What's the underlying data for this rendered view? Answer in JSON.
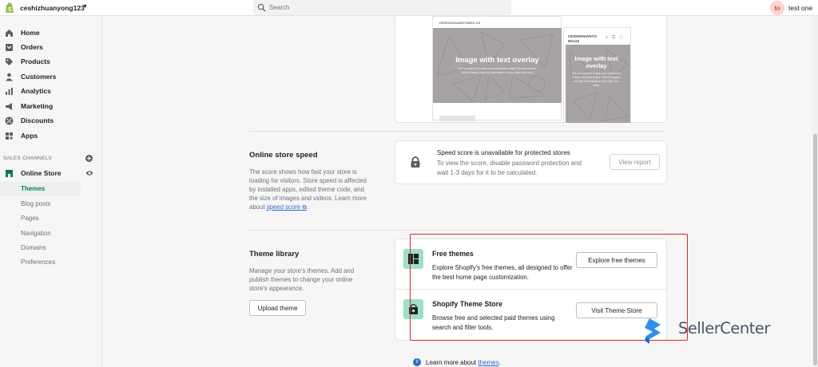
{
  "topbar": {
    "store_name": "ceshizhuanyong123",
    "search_placeholder": "Search",
    "avatar_initials": "to",
    "user_name": "test one"
  },
  "sidebar": {
    "items": [
      {
        "label": "Home",
        "icon": "home-icon"
      },
      {
        "label": "Orders",
        "icon": "orders-icon"
      },
      {
        "label": "Products",
        "icon": "tag-icon"
      },
      {
        "label": "Customers",
        "icon": "person-icon"
      },
      {
        "label": "Analytics",
        "icon": "bar-chart-icon"
      },
      {
        "label": "Marketing",
        "icon": "megaphone-icon"
      },
      {
        "label": "Discounts",
        "icon": "discount-icon"
      },
      {
        "label": "Apps",
        "icon": "apps-icon"
      }
    ],
    "section_title": "SALES CHANNELS",
    "channel": "Online Store",
    "sub_items": [
      "Themes",
      "Blog posts",
      "Pages",
      "Navigation",
      "Domains",
      "Preferences"
    ],
    "active_sub_item": "Themes"
  },
  "preview": {
    "desktop_header": "CESHIZHUANYONG1 23",
    "desktop_title": "Image with text overlay",
    "desktop_sub": "Use overlay text to give your customers insight into your brand. Select imagery and text that relates to your style and story.",
    "mobile_header": "CESHIZHUANYO NG123",
    "mobile_icons": "⌕ ◫ ◇",
    "mobile_title": "Image with text overlay",
    "mobile_sub": "Use overlay text to give your customers insight into your brand. Select imagery and text that relates to your style and story."
  },
  "speed": {
    "title": "Online store speed",
    "description": "The score shows how fast your store is loading for visitors. Store speed is affected by installed apps, edited theme code, and the size of images and videos. Learn more about ",
    "link": "speed score",
    "link_suffix": " .",
    "card_title": "Speed score is unavailable for protected stores",
    "card_desc": "To view the score, disable password protection and wait 1-3 days for it to be calculated.",
    "button": "View report"
  },
  "library": {
    "title": "Theme library",
    "description": "Manage your store's themes. Add and publish themes to change your online store's appearance.",
    "upload_button": "Upload theme",
    "rows": [
      {
        "title": "Free themes",
        "desc": "Explore Shopify's free themes, all designed to offer the best home page customization.",
        "button": "Explore free themes"
      },
      {
        "title": "Shopify Theme Store",
        "desc": "Browse free and selected paid themes using search and filter tools.",
        "button": "Visit Theme Store"
      }
    ]
  },
  "footer": {
    "learn_text": "Learn more about ",
    "learn_link": "themes",
    "learn_suffix": "."
  },
  "watermark": {
    "text": "SellerCenter"
  },
  "colors": {
    "accent": "#008060",
    "link": "#2c6ecb",
    "highlight": "#e3232d",
    "tile": "#9de0c9"
  }
}
